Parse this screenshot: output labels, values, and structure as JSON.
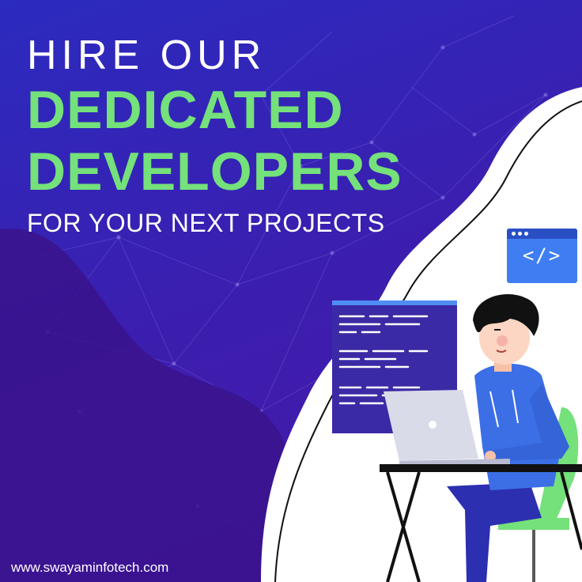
{
  "headline": {
    "line1": "HIRE OUR",
    "line2": "DEDICATED",
    "line3": "DEVELOPERS",
    "line4": "FOR YOUR NEXT PROJECTS"
  },
  "footer": {
    "url": "www.swayaminfotech.com"
  },
  "badge": {
    "tag": "</>"
  },
  "colors": {
    "accent_green": "#74e17a",
    "bg_blue": "#2b2bbf",
    "bg_purple": "#4a17a8",
    "badge_blue": "#3f7ef2",
    "hoodie_blue": "#3c6fe6"
  },
  "icons": [
    "code-window-icon",
    "laptop-icon"
  ]
}
